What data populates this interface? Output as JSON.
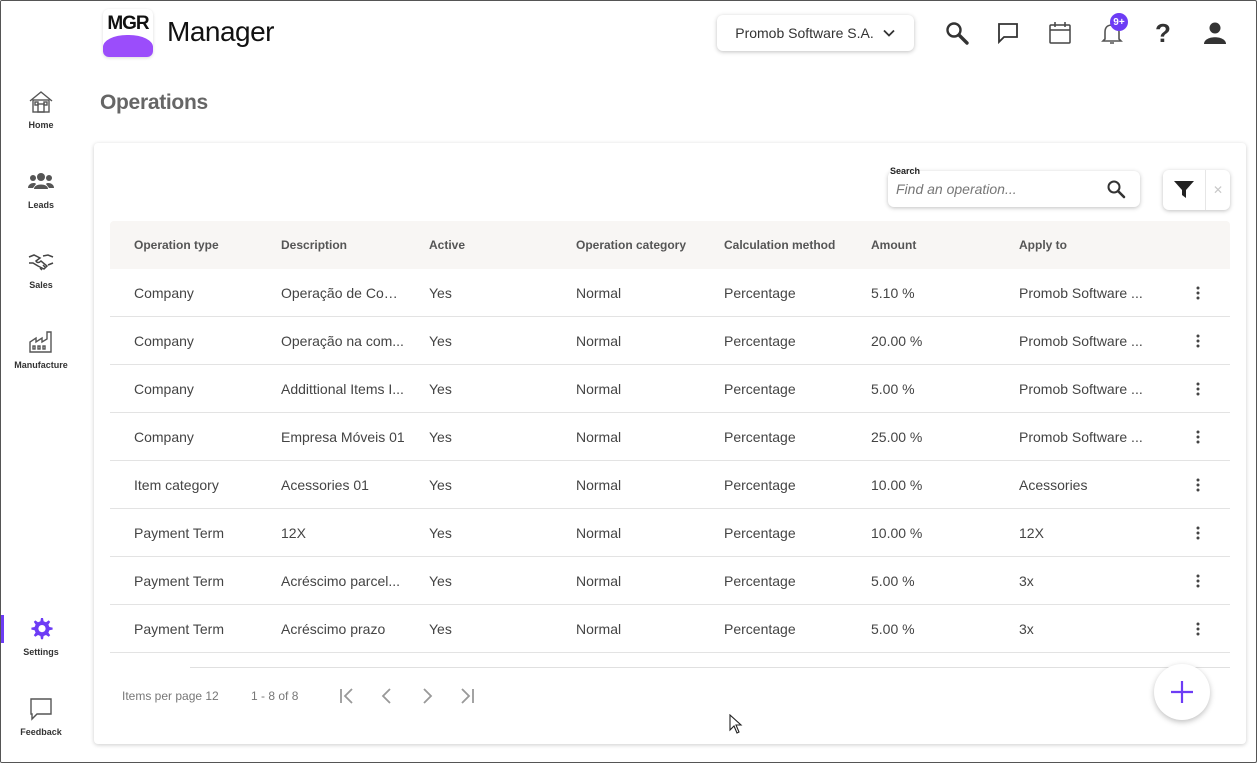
{
  "app": {
    "logo_text": "MGR",
    "title": "Manager"
  },
  "header": {
    "company": "Promob Software S.A.",
    "notification_badge": "9+"
  },
  "sidebar": {
    "items": [
      {
        "label": "Home",
        "icon": "home-icon"
      },
      {
        "label": "Leads",
        "icon": "people-icon"
      },
      {
        "label": "Sales",
        "icon": "handshake-icon"
      },
      {
        "label": "Manufacture",
        "icon": "factory-icon"
      },
      {
        "label": "Settings",
        "icon": "gear-icon",
        "active": true
      },
      {
        "label": "Feedback",
        "icon": "chat-icon"
      }
    ]
  },
  "page": {
    "title": "Operations"
  },
  "search": {
    "label": "Search",
    "placeholder": "Find an operation..."
  },
  "table": {
    "columns": [
      "Operation type",
      "Description",
      "Active",
      "Operation category",
      "Calculation method",
      "Amount",
      "Apply to"
    ],
    "rows": [
      [
        "Company",
        "Operação de Com...",
        "Yes",
        "Normal",
        "Percentage",
        "5.10 %",
        "Promob Software ..."
      ],
      [
        "Company",
        "Operação na com...",
        "Yes",
        "Normal",
        "Percentage",
        "20.00 %",
        "Promob Software ..."
      ],
      [
        "Company",
        "Addittional Items I...",
        "Yes",
        "Normal",
        "Percentage",
        "5.00 %",
        "Promob Software ..."
      ],
      [
        "Company",
        "Empresa Móveis 01",
        "Yes",
        "Normal",
        "Percentage",
        "25.00 %",
        "Promob Software ..."
      ],
      [
        "Item category",
        "Acessories 01",
        "Yes",
        "Normal",
        "Percentage",
        "10.00 %",
        "Acessories"
      ],
      [
        "Payment Term",
        "12X",
        "Yes",
        "Normal",
        "Percentage",
        "10.00 %",
        "12X"
      ],
      [
        "Payment Term",
        "Acréscimo parcel...",
        "Yes",
        "Normal",
        "Percentage",
        "5.00 %",
        "3x"
      ],
      [
        "Payment Term",
        "Acréscimo prazo",
        "Yes",
        "Normal",
        "Percentage",
        "5.00 %",
        "3x"
      ]
    ]
  },
  "paginator": {
    "items_per_page": "Items per page 12",
    "range": "1 - 8 of 8"
  },
  "colors": {
    "accent": "#6d3cf5",
    "logo_purple": "#9b4dfb"
  }
}
